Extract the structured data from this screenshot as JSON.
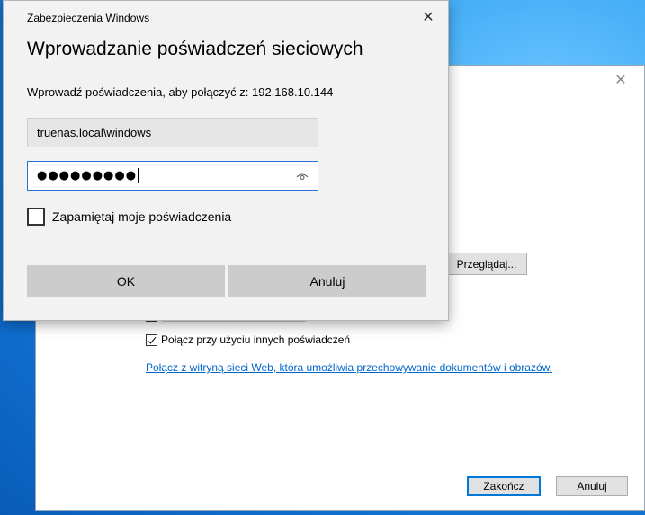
{
  "background_dialog": {
    "close_glyph": "✕",
    "browse_label": "Przeglądaj...",
    "alt_credentials_label": "Połącz przy użyciu innych poświadczeń",
    "alt_credentials_checked": true,
    "web_link": "Połącz z witryną sieci Web, która umożliwia przechowywanie dokumentów i obrazów",
    "web_link_suffix": ".",
    "finish_label": "Zakończ",
    "cancel_label": "Anuluj"
  },
  "credential_dialog": {
    "caption": "Zabezpieczenia Windows",
    "close_glyph": "✕",
    "title": "Wprowadzanie poświadczeń sieciowych",
    "description": "Wprowadź poświadczenia, aby połączyć z: 192.168.10.144",
    "username_value": "truenas.local\\windows",
    "password_masked": "●●●●●●●●●",
    "remember_label": "Zapamiętaj moje poświadczenia",
    "remember_checked": false,
    "ok_label": "OK",
    "cancel_label": "Anuluj"
  },
  "icons": {
    "reveal_password": "eye-icon",
    "checkmark": "checkmark-icon"
  },
  "colors": {
    "desktop": "#1f8fe0",
    "focus_border": "#2b6fd6",
    "link": "#0066cc",
    "button_face": "#cccccc"
  }
}
